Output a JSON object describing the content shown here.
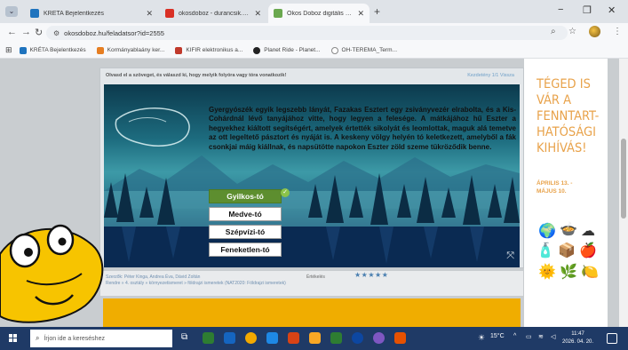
{
  "browser": {
    "tabs": [
      {
        "title": "KRÉTA Bejelentkezés",
        "favicon_color": "#1e73be",
        "active": false
      },
      {
        "title": "okosdoboz - durancsik.eszter@...",
        "favicon_color": "#d93025",
        "active": false
      },
      {
        "title": "Okos Doboz digitális feladatgyű...",
        "favicon_color": "#6aa84f",
        "active": true
      }
    ],
    "new_tab_glyph": "+",
    "url": "okosdoboz.hu/feladatsor?id=2555",
    "bookmarks": [
      {
        "label": "KRÉTA Bejelentkezés",
        "icon_color": "#1e73be"
      },
      {
        "label": "Kormányablaány ker...",
        "icon_color": "#e67e22"
      },
      {
        "label": "KIFIR elektronikus a...",
        "icon_color": "#c0392b"
      },
      {
        "label": "Planet Ride - Planet...",
        "icon_color": "#222222"
      },
      {
        "label": "OH-TEREMA_Term...",
        "icon_color": "#888888"
      }
    ]
  },
  "exercise": {
    "instruction": "Olvasd el a szöveget, és válaszd ki, hogy melyik folyóra vagy tóra vonatkozik!",
    "counter": "Kezdetény  1/1  Vissza",
    "story": "Gyergyószék egyik legszebb lányát, Fazakas Esztert egy zsiványvezér elrabolta, és a Kis-Cohárdnál lévő tanyájához vitte, hogy legyen a felesége. A mátkájához hű Eszter a hegyekhez kiáltott segítségért, amelyek értették sikolyát és leomlottak, maguk alá temetve az ott legeltető pásztort és nyáját is. A keskeny völgy helyén tó keletkezett, amelyből a fák csonkjai máig kiállnak, és napsütötte napokon Eszter zöld szeme tükröződik benne.",
    "options": [
      "Gyilkos-tó",
      "Medve-tó",
      "Szépvízi-tó",
      "Feneketlen-tó"
    ],
    "selected_index": 0,
    "expand_icon": "expand-icon"
  },
  "meta": {
    "authors": "Szerzők: Péter Kinga, Andrea Éva, Dávid Zoltán",
    "path": "Rendre » 4. osztály » környezetismeret » földrajzi ismeretek (NAT2020: Földrajzi ismeretek)",
    "rating_label": "Értékelés",
    "rating_stars": "★★★★★"
  },
  "ad": {
    "title_lines": [
      "TÉGED IS",
      "VÁR A",
      "FENNTART-",
      "HATÓSÁGI",
      "KIHÍVÁS!"
    ],
    "date_lines": [
      "ÁPRILIS 13. -",
      "MÁJUS 10."
    ],
    "color": "#e8a24a"
  },
  "taskbar": {
    "search_placeholder": "Írjon ide a kereséshez",
    "weather": "15°C",
    "time": "11:47",
    "date": "2026. 04. 20."
  }
}
